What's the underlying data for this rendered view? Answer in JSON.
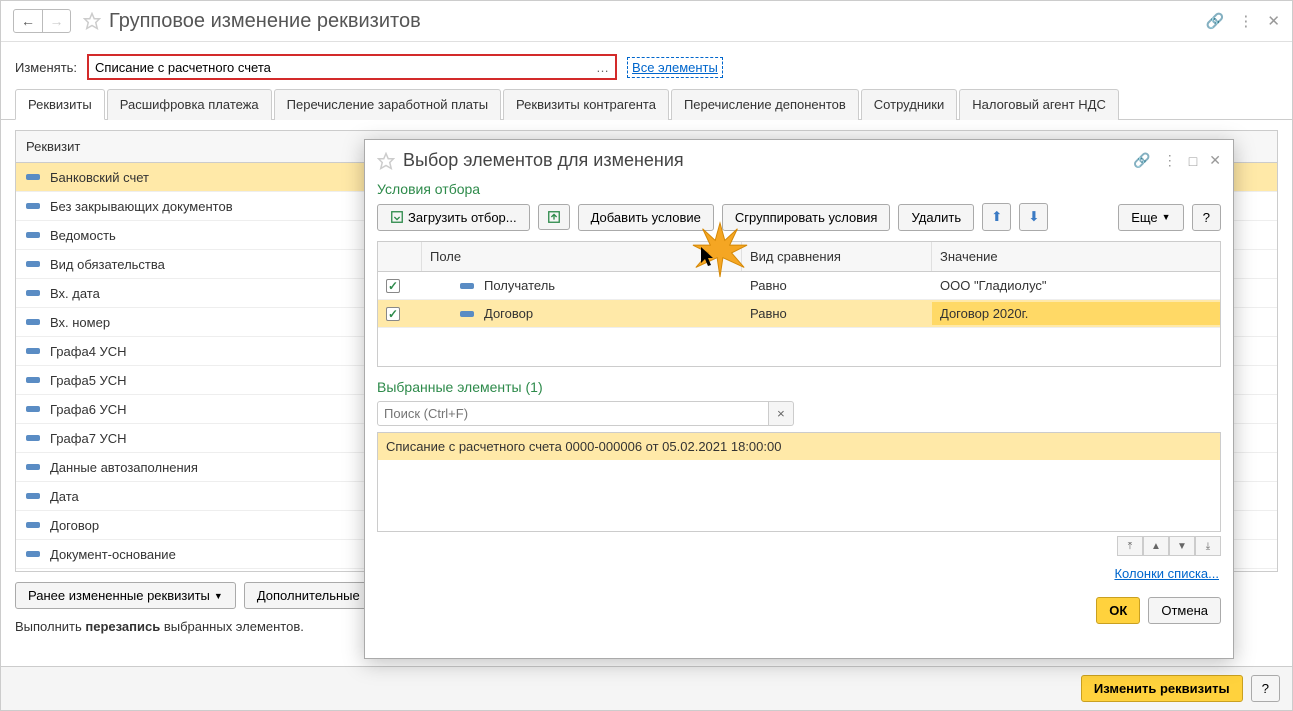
{
  "header": {
    "title": "Групповое изменение реквизитов"
  },
  "form": {
    "change_label": "Изменять:",
    "change_value": "Списание с расчетного счета",
    "all_elements": "Все элементы"
  },
  "tabs": [
    {
      "label": "Реквизиты",
      "active": true
    },
    {
      "label": "Расшифровка платежа"
    },
    {
      "label": "Перечисление заработной платы"
    },
    {
      "label": "Реквизиты контрагента"
    },
    {
      "label": "Перечисление депонентов"
    },
    {
      "label": "Сотрудники"
    },
    {
      "label": "Налоговый агент НДС"
    }
  ],
  "grid": {
    "header": "Реквизит",
    "rows": [
      "Банковский счет",
      "Без закрывающих документов",
      "Ведомость",
      "Вид обязательства",
      "Вх. дата",
      "Вх. номер",
      "Графа4 УСН",
      "Графа5 УСН",
      "Графа6 УСН",
      "Графа7 УСН",
      "Данные автозаполнения",
      "Дата",
      "Договор",
      "Документ-основание"
    ]
  },
  "bottom": {
    "prev_changed": "Ранее измененные реквизиты",
    "additional": "Дополнительные",
    "status_prefix": "Выполнить ",
    "status_bold": "перезапись",
    "status_suffix": " выбранных элементов."
  },
  "footer": {
    "change_req": "Изменить реквизиты",
    "help": "?"
  },
  "modal": {
    "title": "Выбор элементов для изменения",
    "section_filter": "Условия отбора",
    "load_filter": "Загрузить отбор...",
    "add_cond": "Добавить условие",
    "group_cond": "Сгруппировать условия",
    "delete": "Удалить",
    "more": "Еще",
    "help": "?",
    "cond_headers": {
      "field": "Поле",
      "comp": "Вид сравнения",
      "val": "Значение"
    },
    "conditions": [
      {
        "checked": true,
        "field": "Получатель",
        "comp": "Равно",
        "val": "ООО \"Гладиолус\""
      },
      {
        "checked": true,
        "field": "Договор",
        "comp": "Равно",
        "val": "Договор 2020г."
      }
    ],
    "selected_title": "Выбранные элементы (1)",
    "search_placeholder": "Поиск (Ctrl+F)",
    "result": "Списание с расчетного счета 0000-000006 от 05.02.2021 18:00:00",
    "columns_link": "Колонки списка...",
    "ok": "ОК",
    "cancel": "Отмена"
  }
}
